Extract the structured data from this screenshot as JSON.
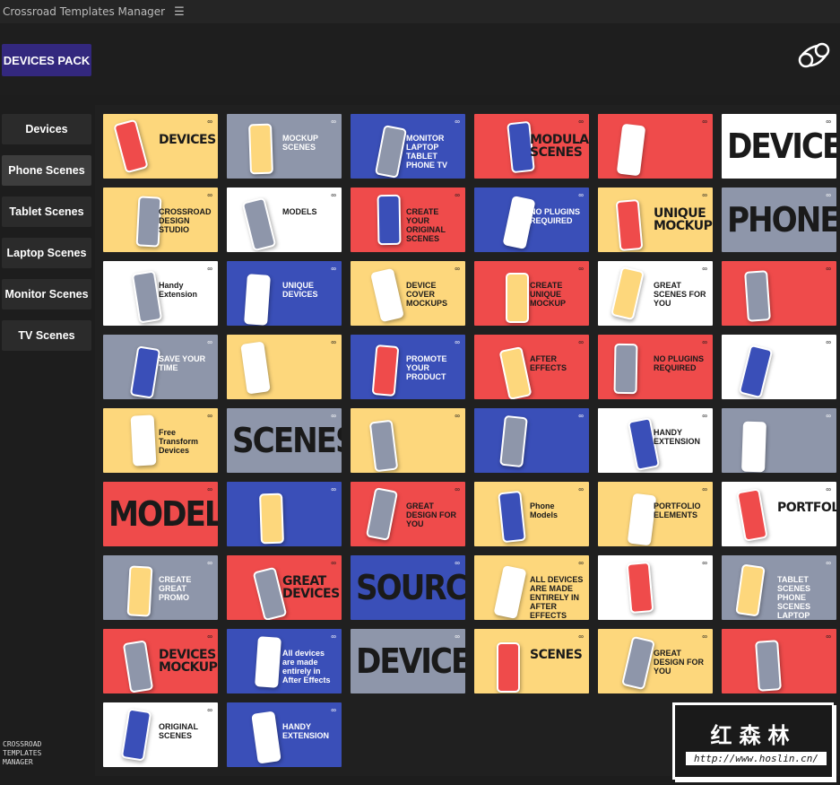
{
  "app_title": "Crossroad Templates Manager",
  "pack_button": "DEVICES PACK",
  "sidebar": [
    {
      "label": "Devices",
      "active": false
    },
    {
      "label": "Phone Scenes",
      "active": true
    },
    {
      "label": "Tablet Scenes",
      "active": false
    },
    {
      "label": "Laptop Scenes",
      "active": false
    },
    {
      "label": "Monitor Scenes",
      "active": false
    },
    {
      "label": "TV Scenes",
      "active": false
    }
  ],
  "footer_label": "CROSSROAD TEMPLATES MANAGER",
  "colors": {
    "yellow": "#fdd77c",
    "gray": "#8e96aa",
    "blue": "#3a4fb8",
    "red": "#ef4b4b",
    "white": "#ffffff",
    "accent": "#33287e"
  },
  "thumbnails": [
    {
      "bg": "yellow",
      "text": "DEVICES",
      "style": "mid"
    },
    {
      "bg": "gray",
      "text": "MOCKUP SCENES"
    },
    {
      "bg": "blue",
      "text": "MONITOR LAPTOP TABLET PHONE TV"
    },
    {
      "bg": "red",
      "text": "MODULAR SCENES",
      "style": "mid"
    },
    {
      "bg": "red",
      "text": ""
    },
    {
      "bg": "white",
      "text": "DEVICES",
      "style": "big"
    },
    {
      "bg": "yellow",
      "text": "CROSSROAD DESIGN STUDIO"
    },
    {
      "bg": "white",
      "text": "MODELS"
    },
    {
      "bg": "red",
      "text": "CREATE YOUR ORIGINAL SCENES"
    },
    {
      "bg": "blue",
      "text": "NO PLUGINS REQUIRED"
    },
    {
      "bg": "yellow",
      "text": "UNIQUE MOCKUPS",
      "style": "mid"
    },
    {
      "bg": "gray",
      "text": "PHONES",
      "style": "big"
    },
    {
      "bg": "white",
      "text": "Handy Extension"
    },
    {
      "bg": "blue",
      "text": "UNIQUE DEVICES"
    },
    {
      "bg": "yellow",
      "text": "DEVICE COVER MOCKUPS"
    },
    {
      "bg": "red",
      "text": "CREATE UNIQUE MOCKUP"
    },
    {
      "bg": "white",
      "text": "GREAT SCENES FOR YOU"
    },
    {
      "bg": "red",
      "text": ""
    },
    {
      "bg": "gray",
      "text": "SAVE YOUR TIME"
    },
    {
      "bg": "yellow",
      "text": ""
    },
    {
      "bg": "blue",
      "text": "PROMOTE YOUR PRODUCT"
    },
    {
      "bg": "red",
      "text": "AFTER EFFECTS"
    },
    {
      "bg": "red",
      "text": "NO PLUGINS REQUIRED"
    },
    {
      "bg": "white",
      "text": ""
    },
    {
      "bg": "yellow",
      "text": "Free Transform Devices"
    },
    {
      "bg": "gray",
      "text": "SCENES",
      "style": "big"
    },
    {
      "bg": "yellow",
      "text": ""
    },
    {
      "bg": "blue",
      "text": ""
    },
    {
      "bg": "white",
      "text": "HANDY EXTENSION"
    },
    {
      "bg": "gray",
      "text": ""
    },
    {
      "bg": "red",
      "text": "MODELS",
      "style": "big"
    },
    {
      "bg": "blue",
      "text": ""
    },
    {
      "bg": "red",
      "text": "GREAT DESIGN FOR YOU"
    },
    {
      "bg": "yellow",
      "text": "Phone Models"
    },
    {
      "bg": "yellow",
      "text": "PORTFOLIO ELEMENTS"
    },
    {
      "bg": "white",
      "text": "PORTFOLIO",
      "style": "mid"
    },
    {
      "bg": "gray",
      "text": "CREATE GREAT PROMO"
    },
    {
      "bg": "red",
      "text": "GREAT DEVICES",
      "style": "mid"
    },
    {
      "bg": "blue",
      "text": "SOURCE",
      "style": "big"
    },
    {
      "bg": "yellow",
      "text": "ALL DEVICES ARE MADE ENTIRELY IN AFTER EFFECTS"
    },
    {
      "bg": "white",
      "text": ""
    },
    {
      "bg": "gray",
      "text": "TABLET SCENES PHONE SCENES LAPTOP SCENES"
    },
    {
      "bg": "red",
      "text": "DEVICES MOCKUPS",
      "style": "mid"
    },
    {
      "bg": "blue",
      "text": "All devices are made entirely in After Effects"
    },
    {
      "bg": "gray",
      "text": "DEVICES",
      "style": "big"
    },
    {
      "bg": "yellow",
      "text": "SCENES",
      "style": "mid"
    },
    {
      "bg": "yellow",
      "text": "GREAT DESIGN FOR YOU"
    },
    {
      "bg": "red",
      "text": ""
    },
    {
      "bg": "white",
      "text": "ORIGINAL SCENES"
    },
    {
      "bg": "blue",
      "text": "HANDY EXTENSION"
    }
  ],
  "watermark": {
    "name": "红森林",
    "url": "http://www.hoslin.cn/"
  }
}
